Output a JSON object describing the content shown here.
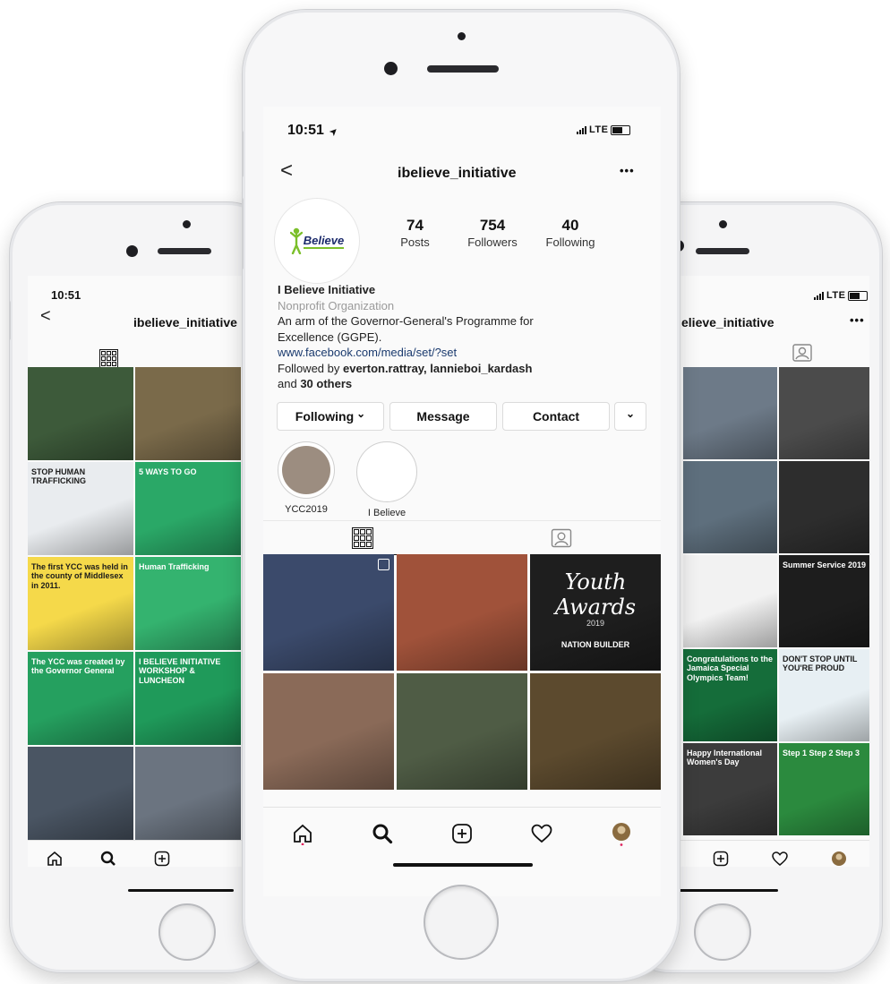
{
  "center": {
    "status_time": "10:51",
    "status_arrow": "➤",
    "network": "LTE",
    "username": "ibelieve_initiative",
    "more": "•••",
    "back": "<",
    "logo_text": "Believe",
    "stats": [
      {
        "value": "74",
        "label": "Posts"
      },
      {
        "value": "754",
        "label": "Followers"
      },
      {
        "value": "40",
        "label": "Following"
      }
    ],
    "name": "I Believe Initiative",
    "category": "Nonprofit Organization",
    "bio_line1": "An arm of the Governor-General's Programme for",
    "bio_line2": "Excellence (GGPE).",
    "link": "www.facebook.com/media/set/?set",
    "followed_prefix": "Followed by ",
    "followed_names": "everton.rattray, lannieboi_kardash",
    "followed_and": "and ",
    "followed_others": "30 others",
    "buttons": {
      "following": "Following",
      "message": "Message",
      "contact": "Contact",
      "chevron": "⌄"
    },
    "highlights": [
      {
        "label": "YCC2019"
      },
      {
        "label": "I Believe"
      }
    ],
    "tiles": [
      {
        "color": "#3b4a6b",
        "cap": ""
      },
      {
        "color": "#a0523a",
        "cap": ""
      },
      {
        "color": "#1e1e1e",
        "cap": "Youth Awards"
      },
      {
        "color": "#8a6a58",
        "cap": ""
      },
      {
        "color": "#4f5c45",
        "cap": ""
      },
      {
        "color": "#5c4a2e",
        "cap": ""
      }
    ],
    "tiles_sub": {
      "award_year": "2019",
      "award_sub": "NATION BUILDER"
    }
  },
  "left": {
    "status_time": "10:51",
    "username": "ibelieve_initiative",
    "back": "<",
    "tiles": [
      {
        "color": "#3d5a3a",
        "cap": "",
        "dark": false
      },
      {
        "color": "#7a6a4a",
        "cap": "",
        "dark": false
      },
      {
        "color": "#e9ecef",
        "cap": "STOP HUMAN TRAFFICKING",
        "dark": true
      },
      {
        "color": "#2aa867",
        "cap": "5 WAYS TO GO",
        "dark": false
      },
      {
        "color": "#f5d94a",
        "cap": "The first YCC was held in the county of Middlesex in 2011.",
        "dark": true
      },
      {
        "color": "#34b36f",
        "cap": "Human Trafficking",
        "dark": false
      },
      {
        "color": "#25a05f",
        "cap": "The YCC was created by the Governor General",
        "dark": false
      },
      {
        "color": "#1f9a5a",
        "cap": "I BELIEVE INITIATIVE WORKSHOP & LUNCHEON",
        "dark": false
      },
      {
        "color": "#4a5563",
        "cap": "",
        "dark": false
      },
      {
        "color": "#6b7480",
        "cap": "",
        "dark": false
      }
    ]
  },
  "right": {
    "network": "LTE",
    "username": "elieve_initiative",
    "more": "•••",
    "tiles": [
      {
        "color": "#6d7a88",
        "cap": "",
        "dark": false
      },
      {
        "color": "#4b4b4b",
        "cap": "",
        "dark": false
      },
      {
        "color": "#5e6f7d",
        "cap": "",
        "dark": false
      },
      {
        "color": "#2d2d2d",
        "cap": "",
        "dark": false
      },
      {
        "color": "#f2f2f2",
        "cap": "",
        "dark": true
      },
      {
        "color": "#1d1d1d",
        "cap": "Summer Service 2019",
        "dark": false
      },
      {
        "color": "#156d3a",
        "cap": "Congratulations to the Jamaica Special Olympics Team!",
        "dark": false
      },
      {
        "color": "#e7eff3",
        "cap": "DON'T STOP UNTIL YOU'RE PROUD",
        "dark": true
      },
      {
        "color": "#3c3c3c",
        "cap": "Happy International Women's Day",
        "dark": false
      },
      {
        "color": "#2b8a3e",
        "cap": "Step 1 Step 2 Step 3",
        "dark": false
      }
    ]
  }
}
